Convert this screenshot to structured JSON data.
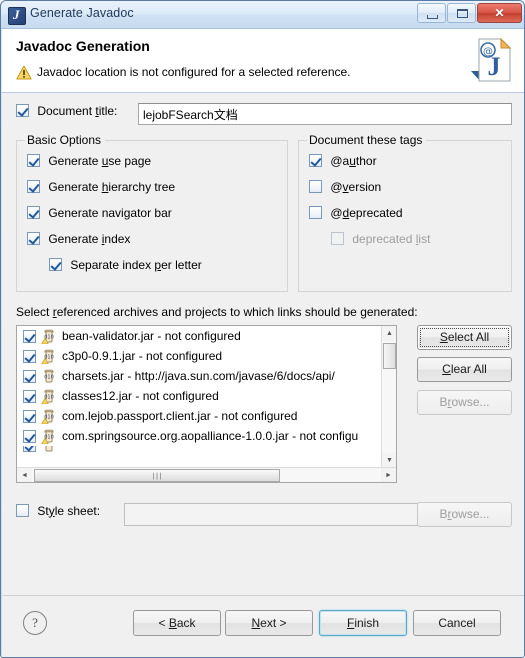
{
  "window": {
    "title": "Generate Javadoc",
    "icon": "javadoc-app-icon",
    "minimize_label": "Minimize",
    "maximize_label": "Maximize",
    "close_label": "Close"
  },
  "header": {
    "title": "Javadoc Generation",
    "message": "Javadoc location is not configured for a selected reference.",
    "warning_icon": "warning-triangle-icon",
    "banner_icon": "javadoc-document-icon"
  },
  "document_title": {
    "checkbox_label_pre": "Document ",
    "checkbox_label_mnemonic": "t",
    "checkbox_label_post": "itle:",
    "checkbox_label_full": "Document title:",
    "checked": true,
    "value": "lejobFSearch文档",
    "placeholder": ""
  },
  "basic_options": {
    "legend": "Basic Options",
    "items": [
      {
        "pre": "Generate ",
        "mn": "u",
        "post": "se page",
        "full": "Generate use page",
        "checked": true,
        "enabled": true,
        "indent": 0
      },
      {
        "pre": "Generate ",
        "mn": "h",
        "post": "ierarchy tree",
        "full": "Generate hierarchy tree",
        "checked": true,
        "enabled": true,
        "indent": 0
      },
      {
        "pre": "Generate navigator bar",
        "mn": "",
        "post": "",
        "full": "Generate navigator bar",
        "checked": true,
        "enabled": true,
        "indent": 0
      },
      {
        "pre": "Generate ",
        "mn": "i",
        "post": "ndex",
        "full": "Generate index",
        "checked": true,
        "enabled": true,
        "indent": 0
      },
      {
        "pre": "Separate index ",
        "mn": "p",
        "post": "er letter",
        "full": "Separate index per letter",
        "checked": true,
        "enabled": true,
        "indent": 1
      }
    ]
  },
  "document_tags": {
    "legend": "Document these tags",
    "items": [
      {
        "pre": "@a",
        "mn": "u",
        "post": "thor",
        "full": "@author",
        "checked": true,
        "enabled": true,
        "indent": 0
      },
      {
        "pre": "@",
        "mn": "v",
        "post": "ersion",
        "full": "@version",
        "checked": false,
        "enabled": true,
        "indent": 0
      },
      {
        "pre": "@",
        "mn": "d",
        "post": "eprecated",
        "full": "@deprecated",
        "checked": false,
        "enabled": true,
        "indent": 0
      },
      {
        "pre": "deprecated ",
        "mn": "l",
        "post": "ist",
        "full": "deprecated list",
        "checked": false,
        "enabled": false,
        "indent": 1
      }
    ]
  },
  "archives": {
    "label_pre": "Select ",
    "label_mn": "r",
    "label_post": "eferenced archives and projects to which links should be generated:",
    "label_full": "Select referenced archives and projects to which links should be generated:",
    "items": [
      {
        "icon": "jar-warning-icon",
        "checked": true,
        "text": "bean-validator.jar - not configured"
      },
      {
        "icon": "jar-warning-icon",
        "checked": true,
        "text": "c3p0-0.9.1.jar - not configured"
      },
      {
        "icon": "jar-icon",
        "checked": true,
        "text": "charsets.jar - http://java.sun.com/javase/6/docs/api/"
      },
      {
        "icon": "jar-warning-icon",
        "checked": true,
        "text": "classes12.jar - not configured"
      },
      {
        "icon": "jar-warning-icon",
        "checked": true,
        "text": "com.lejob.passport.client.jar - not configured"
      },
      {
        "icon": "jar-warning-icon",
        "checked": true,
        "text": "com.springsource.org.aopalliance-1.0.0.jar - not configu"
      }
    ],
    "scroll": {
      "vertical_up": "▲",
      "vertical_down": "▼",
      "horizontal_left": "◄",
      "horizontal_right": "►",
      "grip": "∣∣∣"
    }
  },
  "side_buttons": {
    "select_all": {
      "pre": "",
      "mn": "S",
      "post": "elect All",
      "full": "Select All",
      "enabled": true,
      "focused": true
    },
    "clear_all": {
      "pre": "",
      "mn": "C",
      "post": "lear All",
      "full": "Clear All",
      "enabled": true,
      "focused": false
    },
    "browse": {
      "pre": "B",
      "mn": "r",
      "post": "owse...",
      "full": "Browse...",
      "enabled": false,
      "focused": false
    }
  },
  "style_sheet": {
    "checkbox_pre": "St",
    "checkbox_mn": "y",
    "checkbox_post": "le sheet:",
    "checkbox_full": "Style sheet:",
    "checked": false,
    "value": "",
    "browse": {
      "pre": "B",
      "mn": "r",
      "post": "owse...",
      "full": "Browse...",
      "enabled": false
    }
  },
  "footer": {
    "help_label": "?",
    "buttons": [
      {
        "pre": "< ",
        "mn": "B",
        "post": "ack",
        "full": "< Back",
        "default": false
      },
      {
        "pre": "",
        "mn": "N",
        "post": "ext >",
        "full": "Next >",
        "default": false
      },
      {
        "pre": "",
        "mn": "F",
        "post": "inish",
        "full": "Finish",
        "default": true
      },
      {
        "pre": "Cancel",
        "mn": "",
        "post": "",
        "full": "Cancel",
        "default": false
      }
    ]
  },
  "colors": {
    "window_frame": "#5a7ba4",
    "title_gradient_top": "#eaf2fb",
    "content_bg": "#f0f0f0",
    "close_button": "#c33f30",
    "default_button_glow": "#5ba7c4",
    "check_mark": "#21599c"
  }
}
